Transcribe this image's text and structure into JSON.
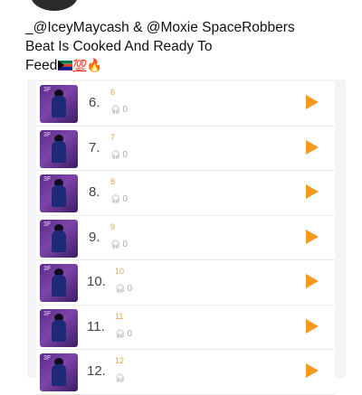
{
  "post": {
    "line1": "_@IceyMaycash & @Moxie SpaceRobbers",
    "line2": "Beat Is Cooked And Ready To",
    "line3": "Feed",
    "emoji_hundred": "💯",
    "emoji_fire": "🔥"
  },
  "tracks": [
    {
      "number": "6.",
      "sub": "6",
      "plays": "0"
    },
    {
      "number": "7.",
      "sub": "7",
      "plays": "0"
    },
    {
      "number": "8.",
      "sub": "8",
      "plays": "0"
    },
    {
      "number": "9.",
      "sub": "9",
      "plays": "0"
    },
    {
      "number": "10.",
      "sub": "10",
      "plays": "0"
    },
    {
      "number": "11.",
      "sub": "11",
      "plays": "0"
    },
    {
      "number": "12.",
      "sub": "12",
      "plays": ""
    }
  ],
  "icons": {
    "play": "play-icon",
    "headphones": "headphones-icon",
    "flag": "south-africa-flag-icon"
  },
  "colors": {
    "accent": "#f39a1e",
    "sub_text": "#e0a64c",
    "thumb": "#6a3594"
  }
}
